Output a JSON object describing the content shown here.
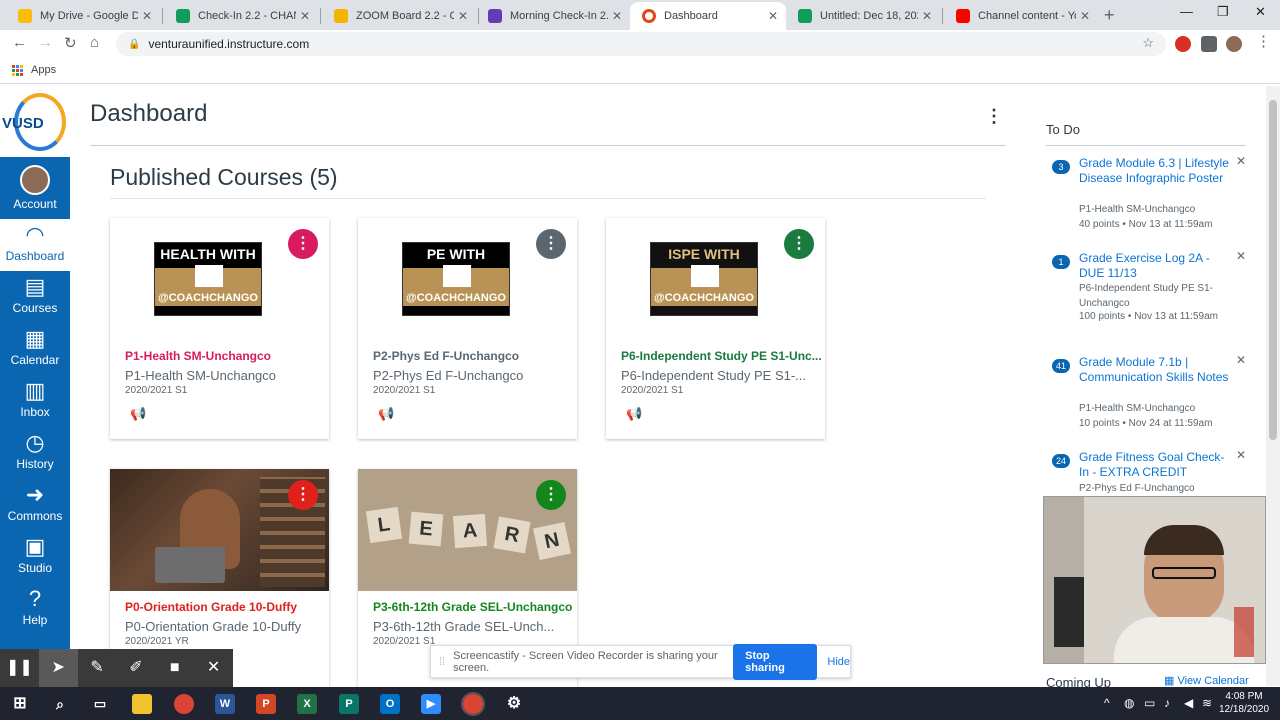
{
  "browser": {
    "tabs": [
      {
        "title": "My Drive - Google Drive",
        "color": "#fbbc04"
      },
      {
        "title": "Check-In 2.2 - CHANGO",
        "color": "#0f9d58"
      },
      {
        "title": "ZOOM Board 2.2 - Google",
        "color": "#f4b400"
      },
      {
        "title": "Morning Check-In 2.2",
        "color": "#673ab7"
      },
      {
        "title": "Dashboard",
        "color": "#e0461b"
      },
      {
        "title": "Untitled: Dec 18, 2020",
        "color": "#0f9d58"
      },
      {
        "title": "Channel content - YouTube",
        "color": "#ff0000"
      }
    ],
    "url": "venturaunified.instructure.com",
    "bookmarks_apps": "Apps"
  },
  "gnav": {
    "logo": "VUSD",
    "items": [
      {
        "label": "Account",
        "icon": "avatar"
      },
      {
        "label": "Dashboard",
        "icon": "speedometer-icon"
      },
      {
        "label": "Courses",
        "icon": "book-icon"
      },
      {
        "label": "Calendar",
        "icon": "calendar-icon"
      },
      {
        "label": "Inbox",
        "icon": "inbox-icon"
      },
      {
        "label": "History",
        "icon": "clock-icon"
      },
      {
        "label": "Commons",
        "icon": "commons-icon"
      },
      {
        "label": "Studio",
        "icon": "studio-icon"
      },
      {
        "label": "Help",
        "icon": "help-icon"
      }
    ]
  },
  "main": {
    "title": "Dashboard",
    "section_title": "Published Courses (5)",
    "cards": [
      {
        "badge_top": "HEALTH WITH",
        "badge_bottom": "@COACHCHANGO",
        "code": "P1-Health SM-Unchangco",
        "name": "P1-Health SM-Unchangco",
        "term": "2020/2021 S1",
        "color": "#d81b60"
      },
      {
        "badge_top": "PE WITH",
        "badge_bottom": "@COACHCHANGO",
        "code": "P2-Phys Ed F-Unchangco",
        "name": "P2-Phys Ed F-Unchangco",
        "term": "2020/2021 S1",
        "color": "#5b6770"
      },
      {
        "badge_top": "ISPE WITH",
        "badge_bottom": "@COACHCHANGO",
        "code": "P6-Independent Study PE S1-Unc...",
        "name": "P6-Independent Study PE S1-...",
        "term": "2020/2021 S1",
        "color": "#1b7a3e"
      },
      {
        "code": "P0-Orientation Grade 10-Duffy",
        "name": "P0-Orientation Grade 10-Duffy",
        "term": "2020/2021 YR",
        "color": "#e0201b"
      },
      {
        "code": "P3-6th-12th Grade SEL-Unchangco",
        "name": "P3-6th-12th Grade SEL-Unch...",
        "term": "2020/2021 S1",
        "color": "#13871c"
      }
    ]
  },
  "todo": {
    "heading": "To Do",
    "items": [
      {
        "count": "3",
        "title": "Grade Module 6.3 | Lifestyle Disease Infographic Poster",
        "course": "P1-Health SM-Unchangco",
        "meta": "40 points • Nov 13 at 11:59am"
      },
      {
        "count": "1",
        "title": "Grade Exercise Log 2A - DUE 11/13",
        "course": "P6-Independent Study PE S1-Unchangco",
        "meta": "100 points • Nov 13 at 11:59am"
      },
      {
        "count": "41",
        "title": "Grade Module 7.1b | Communication Skills Notes",
        "course": "P1-Health SM-Unchangco",
        "meta": "10 points • Nov 24 at 11:59am"
      },
      {
        "count": "24",
        "title": "Grade Fitness Goal Check-In - EXTRA CREDIT",
        "course": "P2-Phys Ed F-Unchangco",
        "meta": ""
      }
    ],
    "coming_up": "Coming Up",
    "view_calendar": "View Calendar"
  },
  "screencastify": {
    "message": "Screencastify - Screen Video Recorder is sharing your screen.",
    "stop": "Stop sharing",
    "hide": "Hide"
  },
  "taskbar": {
    "time": "4:08 PM",
    "date": "12/18/2020"
  }
}
